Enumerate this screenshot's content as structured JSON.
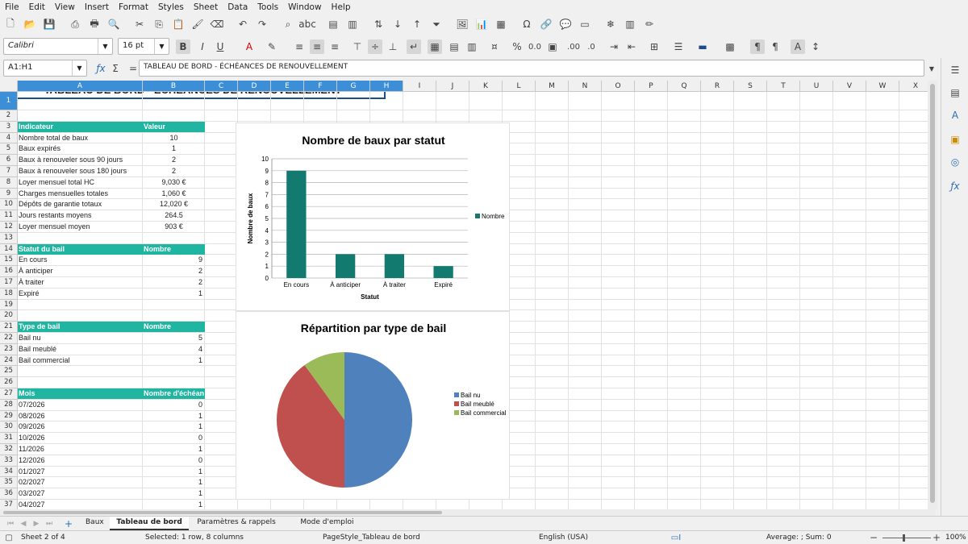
{
  "menu": [
    "File",
    "Edit",
    "View",
    "Insert",
    "Format",
    "Styles",
    "Sheet",
    "Data",
    "Tools",
    "Window",
    "Help"
  ],
  "toolbar": {
    "font_name": "Calibri",
    "font_size": "16 pt",
    "icons": [
      "new-icon",
      "open-icon",
      "save-icon",
      "export-pdf-icon",
      "print-icon",
      "print-preview-icon",
      "cut-icon",
      "copy-icon",
      "paste-icon",
      "clone-icon",
      "clear-icon",
      "undo-icon",
      "redo-icon",
      "find-icon",
      "spelling-icon",
      "row-icon",
      "column-icon",
      "sort-icon",
      "sort-ascending-icon",
      "sort-descending-icon",
      "autofilter-icon",
      "image-icon",
      "chart-icon",
      "pivot-icon",
      "special-char-icon",
      "hyperlink-icon",
      "comment-icon",
      "header-footer-icon",
      "freeze-icon",
      "split-icon",
      "show-draw-icon"
    ]
  },
  "formula": {
    "name_box": "A1:H1",
    "content": "TABLEAU DE BORD - ÉCHÉANCES DE RENOUVELLEMENT"
  },
  "columns": [
    "A",
    "B",
    "C",
    "D",
    "E",
    "F",
    "G",
    "H",
    "I",
    "J",
    "K",
    "L",
    "M",
    "N",
    "O",
    "P",
    "Q",
    "R",
    "S",
    "T",
    "U",
    "V",
    "W",
    "X"
  ],
  "rows": [
    "1",
    "2",
    "3",
    "4",
    "5",
    "6",
    "7",
    "8",
    "9",
    "10",
    "11",
    "12",
    "13",
    "14",
    "15",
    "16",
    "17",
    "18",
    "19",
    "20",
    "21",
    "22",
    "23",
    "24",
    "25",
    "26",
    "27",
    "28",
    "29",
    "30",
    "31",
    "32",
    "33",
    "34",
    "35",
    "36",
    "37"
  ],
  "sheet": {
    "title": "TABLEAU DE BORD - ÉCHÉANCES DE RENOUVELLEMENT",
    "kpi_header": [
      "Indicateur",
      "Valeur"
    ],
    "kpis": [
      [
        "Nombre total de baux",
        "10"
      ],
      [
        "Baux expirés",
        "1"
      ],
      [
        "Baux à renouveler sous 90 jours",
        "2"
      ],
      [
        "Baux à renouveler sous 180 jours",
        "2"
      ],
      [
        "Loyer mensuel total HC",
        "9,030 €"
      ],
      [
        "Charges mensuelles totales",
        "1,060 €"
      ],
      [
        "Dépôts de garantie totaux",
        "12,020 €"
      ],
      [
        "Jours restants moyens",
        "264.5"
      ],
      [
        "Loyer mensuel moyen",
        "903 €"
      ]
    ],
    "status_header": [
      "Statut du bail",
      "Nombre"
    ],
    "status_rows": [
      [
        "En cours",
        "9"
      ],
      [
        "À anticiper",
        "2"
      ],
      [
        "À traiter",
        "2"
      ],
      [
        "Expiré",
        "1"
      ]
    ],
    "type_header": [
      "Type de bail",
      "Nombre"
    ],
    "type_rows": [
      [
        "Bail nu",
        "5"
      ],
      [
        "Bail meublé",
        "4"
      ],
      [
        "Bail commercial",
        "1"
      ]
    ],
    "month_header": [
      "Mois",
      "Nombre d'échéan"
    ],
    "month_rows": [
      [
        "07/2026",
        "0"
      ],
      [
        "08/2026",
        "1"
      ],
      [
        "09/2026",
        "1"
      ],
      [
        "10/2026",
        "0"
      ],
      [
        "11/2026",
        "1"
      ],
      [
        "12/2026",
        "0"
      ],
      [
        "01/2027",
        "1"
      ],
      [
        "02/2027",
        "1"
      ],
      [
        "03/2027",
        "1"
      ],
      [
        "04/2027",
        "1"
      ]
    ]
  },
  "chart_data": [
    {
      "type": "bar",
      "title": "Nombre de baux par statut",
      "xlabel": "Statut",
      "ylabel": "Nombre de baux",
      "categories": [
        "En cours",
        "À anticiper",
        "À traiter",
        "Expiré"
      ],
      "series": [
        {
          "name": "Nombre",
          "values": [
            9,
            2,
            2,
            1
          ]
        }
      ],
      "ylim": [
        0,
        10
      ],
      "yticks": [
        "0",
        "1",
        "2",
        "3",
        "4",
        "5",
        "6",
        "7",
        "8",
        "9",
        "10"
      ],
      "grid": true,
      "legend": "right",
      "color": "#137a70"
    },
    {
      "type": "pie",
      "title": "Répartition par type de bail",
      "labels": [
        "Bail nu",
        "Bail meublé",
        "Bail commercial"
      ],
      "values": [
        5,
        4,
        1
      ],
      "colors": [
        "#4f81bd",
        "#c0504d",
        "#9bbb59"
      ],
      "legend": "right"
    }
  ],
  "sheet_tabs": [
    "Baux",
    "Tableau de bord",
    "Paramètres & rappels",
    "Mode d'emploi"
  ],
  "active_tab": "Tableau de bord",
  "status": {
    "sheet": "Sheet 2 of 4",
    "selection": "Selected: 1 row, 8 columns",
    "page_style": "PageStyle_Tableau de bord",
    "language": "English (USA)",
    "sum": "Average: ; Sum: 0",
    "zoom": "100%"
  }
}
